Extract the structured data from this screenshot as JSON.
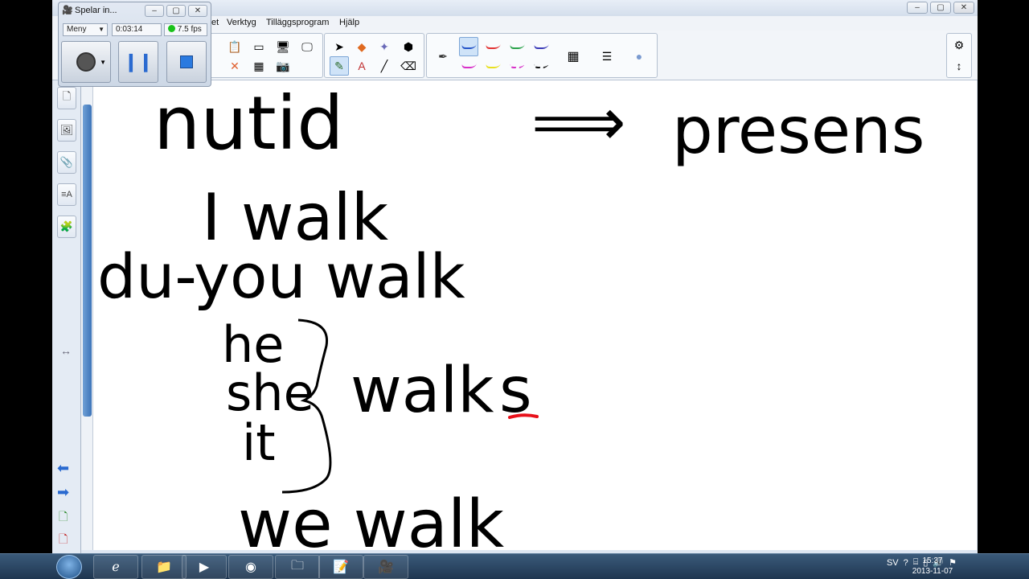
{
  "window": {
    "controls": {
      "minimize": "–",
      "maximize": "▢",
      "close": "✕"
    }
  },
  "menubar": {
    "items": [
      "et",
      "Verktyg",
      "Tilläggsprogram",
      "Hjälp"
    ]
  },
  "recorder": {
    "title": "Spelar in...",
    "menu_label": "Meny",
    "elapsed": "0:03:14",
    "fps": "7.5 fps",
    "controls": {
      "minimize": "–",
      "maximize": "▢",
      "close": "✕"
    }
  },
  "handwriting": {
    "line1": "nutid",
    "arrow": "⟹",
    "line1_right": "presens",
    "line2": "I walk",
    "line3_prefix": "du-",
    "line3": "you walk",
    "pronoun_he": "he",
    "pronoun_she": "she",
    "pronoun_it": "it",
    "walks_stem": "walk",
    "walks_suffix": "s",
    "line_we": "we walk"
  },
  "colors": {
    "ink": "#000000",
    "highlight_red": "#e8101a",
    "pen_blue": "#2454c8",
    "pen_red": "#e23232",
    "pen_green": "#2aa24a",
    "pen_purple": "#3a3ab8",
    "pen_magenta": "#d830c8",
    "pen_yellow": "#e8e020",
    "record_green": "#19c219"
  },
  "taskbar": {
    "language": "SV",
    "time": "15:37",
    "date": "2013-11-07"
  }
}
